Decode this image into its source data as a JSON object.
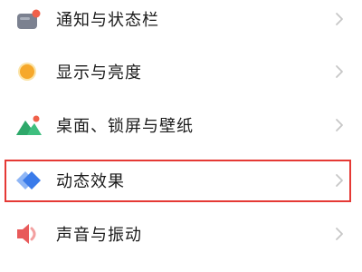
{
  "settings_list": {
    "items": [
      {
        "label": "通知与状态栏",
        "icon": "notification-icon",
        "icon_color": "#6f7684",
        "badge_color": "#f0604a"
      },
      {
        "label": "显示与亮度",
        "icon": "brightness-icon",
        "icon_color": "#f5a623"
      },
      {
        "label": "桌面、锁屏与壁纸",
        "icon": "wallpaper-icon",
        "icon_color": "#3fbf7f",
        "badge_color": "#f0604a"
      },
      {
        "label": "动态效果",
        "icon": "animation-icon",
        "icon_color": "#3a7bea",
        "highlighted": true
      },
      {
        "label": "声音与振动",
        "icon": "sound-icon",
        "icon_color": "#e85a5a"
      }
    ],
    "chevron_icon": "chevron-right-icon",
    "chevron_color": "#c7c7c7"
  },
  "highlight": {
    "target": "动态效果",
    "color": "#e53935"
  }
}
